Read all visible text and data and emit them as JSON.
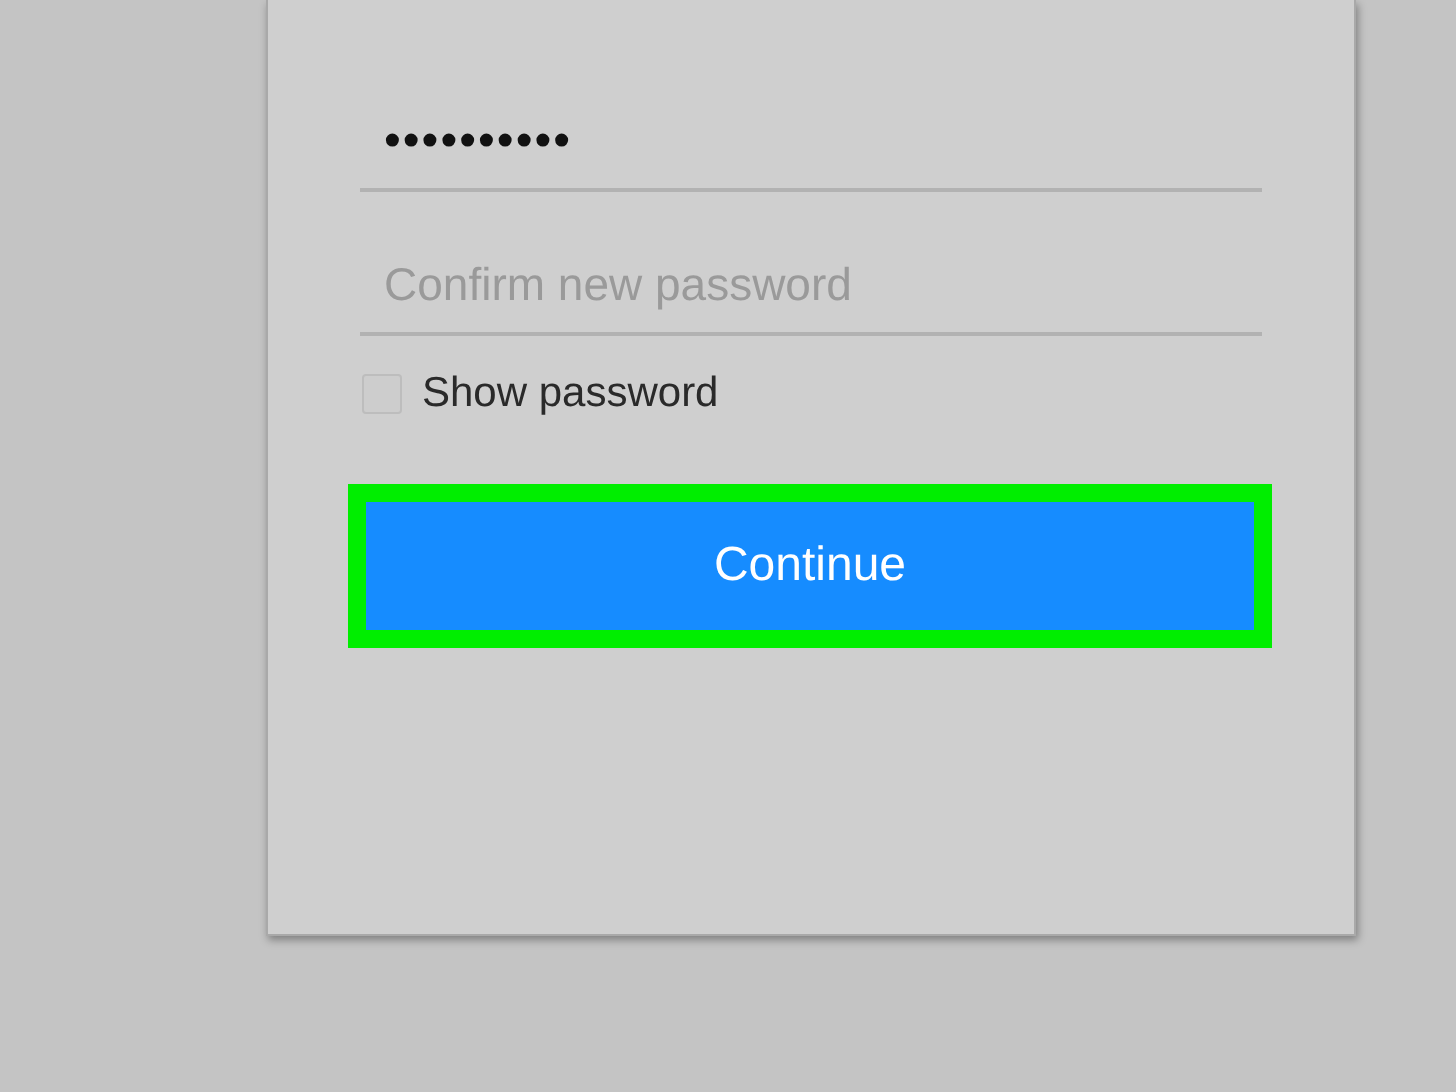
{
  "password_field": {
    "value": "••••••••••"
  },
  "confirm_field": {
    "placeholder": "Confirm new password"
  },
  "show_password": {
    "label": "Show password",
    "checked": false
  },
  "continue_button": {
    "label": "Continue",
    "highlighted": true
  }
}
